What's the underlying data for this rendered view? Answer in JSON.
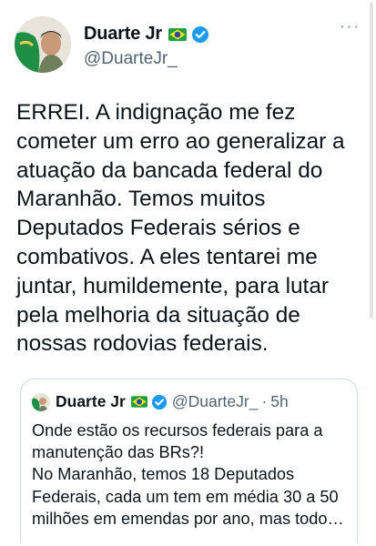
{
  "author": {
    "display_name": "Duarte Jr",
    "flag_icon": "brazil-flag-icon",
    "verified_icon": "verified-badge-icon",
    "handle": "@DuarteJr_"
  },
  "more_icon": "more-options-icon",
  "tweet": {
    "text": "ERREI. A indignação me fez\ncometer um erro ao generalizar a\natuação da bancada federal do\nMaranhão. Temos muitos\nDeputados Federais sérios e\ncombativos. A eles tentarei me\njuntar, humildemente, para lutar\npela melhoria da situação de\nnossas rodovias federais."
  },
  "quoted_tweet": {
    "display_name": "Duarte Jr",
    "handle": "@DuarteJr_",
    "separator": "·",
    "time": "5h",
    "text": "Onde estão os recursos federais para a\nmanutenção das BRs?!\nNo Maranhão, temos 18 Deputados\nFederais, cada um tem em média 30 a 50\nmilhões em emendas por ano, mas todo…"
  },
  "colors": {
    "text": "#0f1419",
    "secondary": "#536471",
    "verified": "#1d9bf0",
    "border": "#cfd9de"
  }
}
